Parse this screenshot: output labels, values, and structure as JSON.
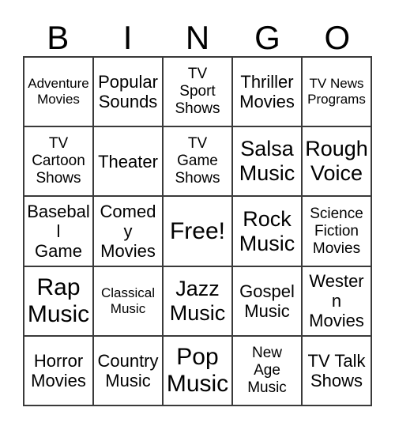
{
  "card": {
    "title": "BINGO",
    "header_letters": [
      "B",
      "I",
      "N",
      "G",
      "O"
    ],
    "free_space_label": "Free!",
    "colors": {
      "background": "#ffffff",
      "grid_line": "#3a3a3a",
      "text": "#000000"
    },
    "rows": [
      [
        {
          "label": "Adventure\nMovies",
          "size": "sz-sm"
        },
        {
          "label": "Popular\nSounds",
          "size": "sz-lg"
        },
        {
          "label": "TV\nSport\nShows",
          "size": "sz-md"
        },
        {
          "label": "Thriller\nMovies",
          "size": "sz-lg"
        },
        {
          "label": "TV News\nPrograms",
          "size": "sz-sm"
        }
      ],
      [
        {
          "label": "TV\nCartoon\nShows",
          "size": "sz-md"
        },
        {
          "label": "Theater",
          "size": "sz-lg"
        },
        {
          "label": "TV\nGame\nShows",
          "size": "sz-md"
        },
        {
          "label": "Salsa\nMusic",
          "size": "sz-xl"
        },
        {
          "label": "Rough\nVoice",
          "size": "sz-xl"
        }
      ],
      [
        {
          "label": "Baseball\nGame",
          "size": "sz-lg"
        },
        {
          "label": "Comedy\nMovies",
          "size": "sz-lg"
        },
        {
          "label": "Free!",
          "size": "sz-xxl"
        },
        {
          "label": "Rock\nMusic",
          "size": "sz-xl"
        },
        {
          "label": "Science\nFiction\nMovies",
          "size": "sz-md"
        }
      ],
      [
        {
          "label": "Rap\nMusic",
          "size": "sz-xxl"
        },
        {
          "label": "Classical\nMusic",
          "size": "sz-sm"
        },
        {
          "label": "Jazz\nMusic",
          "size": "sz-xl"
        },
        {
          "label": "Gospel\nMusic",
          "size": "sz-lg"
        },
        {
          "label": "Western\nMovies",
          "size": "sz-lg"
        }
      ],
      [
        {
          "label": "Horror\nMovies",
          "size": "sz-lg"
        },
        {
          "label": "Country\nMusic",
          "size": "sz-lg"
        },
        {
          "label": "Pop\nMusic",
          "size": "sz-xxl"
        },
        {
          "label": "New\nAge\nMusic",
          "size": "sz-md"
        },
        {
          "label": "TV Talk\nShows",
          "size": "sz-lg"
        }
      ]
    ]
  }
}
